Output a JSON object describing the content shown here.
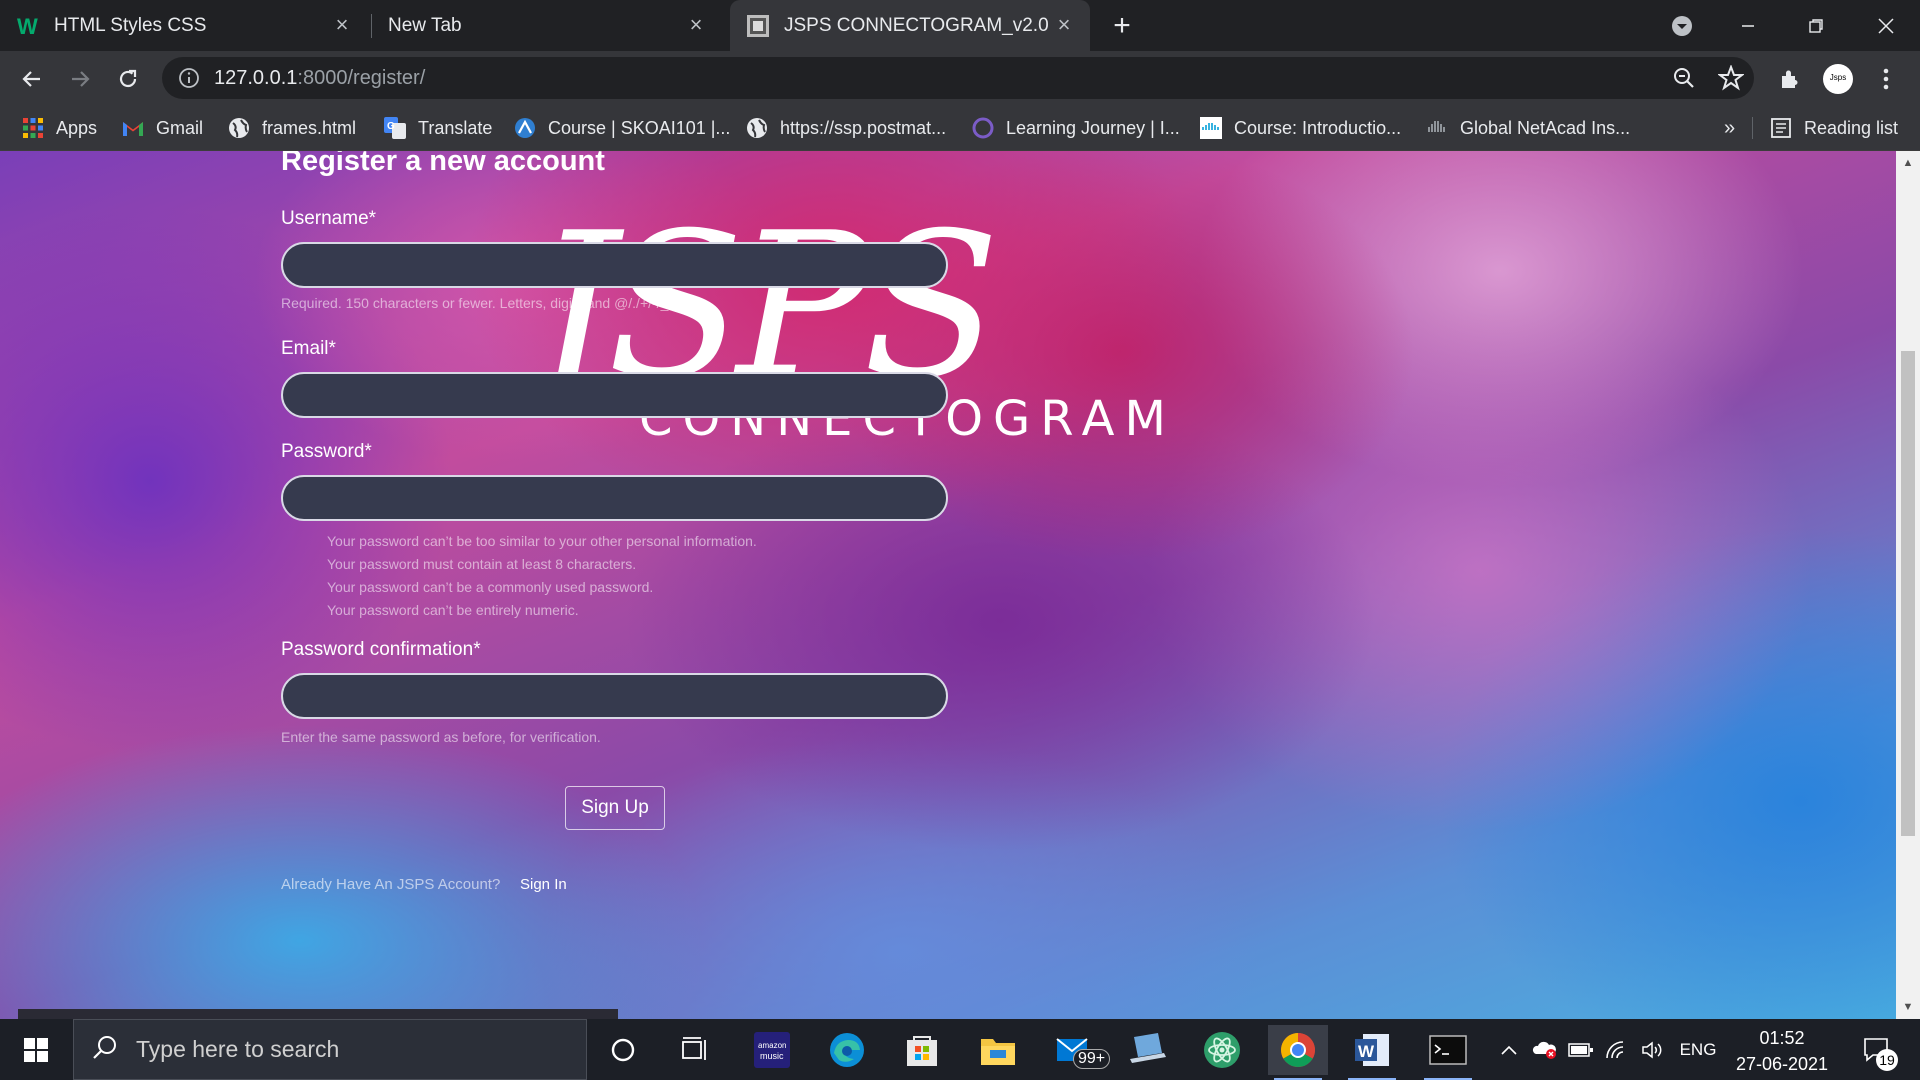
{
  "browser": {
    "tabs": [
      {
        "title": "HTML Styles CSS",
        "active": false
      },
      {
        "title": "New Tab",
        "active": false
      },
      {
        "title": "JSPS CONNECTOGRAM_v2.0",
        "active": true
      }
    ],
    "address": {
      "host": "127.0.0.1",
      "rest": ":8000/register/"
    },
    "bookmarks": [
      {
        "label": "Apps",
        "icon": "apps-grid-icon"
      },
      {
        "label": "Gmail",
        "icon": "gmail-icon"
      },
      {
        "label": "frames.html",
        "icon": "globe-icon"
      },
      {
        "label": "Translate",
        "icon": "translate-icon"
      },
      {
        "label": "Course | SKOAI101 |...",
        "icon": "course-icon"
      },
      {
        "label": "https://ssp.postmat...",
        "icon": "globe-icon"
      },
      {
        "label": "Learning Journey | I...",
        "icon": "learning-icon"
      },
      {
        "label": "Course: Introductio...",
        "icon": "cisco-icon"
      },
      {
        "label": "Global NetAcad Ins...",
        "icon": "cisco-icon"
      }
    ],
    "bookmarks_overflow": "»",
    "reading_list": "Reading list",
    "profile_label": "Jsps"
  },
  "page": {
    "logo_mark": "JSPS",
    "logo_text": "CONNECTOGRAM",
    "form_title": "Register a new account",
    "username_label": "Username*",
    "username_help": "Required. 150 characters or fewer. Letters, digits and @/./+/-/_ only.",
    "email_label": "Email*",
    "password_label": "Password*",
    "password_rules": [
      "Your password can’t be too similar to your other personal information.",
      "Your password must contain at least 8 characters.",
      "Your password can’t be a commonly used password.",
      "Your password can’t be entirely numeric."
    ],
    "confirm_label": "Password confirmation*",
    "confirm_help": "Enter the same password as before, for verification.",
    "signup_label": "Sign Up",
    "already_text": "Already Have An JSPS Account?",
    "signin_label": "Sign In"
  },
  "taskbar": {
    "search_placeholder": "Type here to search",
    "mail_badge": "99+",
    "language": "ENG",
    "time": "01:52",
    "date": "27-06-2021",
    "notification_count": "19"
  }
}
